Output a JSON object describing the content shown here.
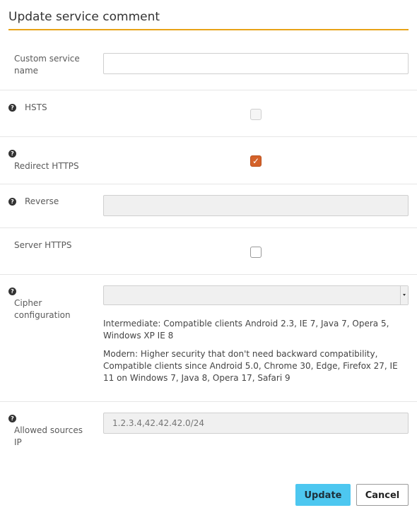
{
  "dialog": {
    "title": "Update service comment"
  },
  "fields": {
    "custom_service_name": {
      "label": "Custom service name",
      "value": ""
    },
    "hsts": {
      "label": "HSTS",
      "checked": false,
      "disabled": true
    },
    "redirect_https": {
      "label": "Redirect HTTPS",
      "checked": true
    },
    "reverse": {
      "label": "Reverse",
      "value": ""
    },
    "server_https": {
      "label": "Server HTTPS",
      "checked": false
    },
    "cipher_configuration": {
      "label_line1": "Cipher",
      "label_line2": "configuration",
      "selected": "",
      "help_intermediate": "Intermediate: Compatible clients Android 2.3, IE 7, Java 7, Opera 5, Windows XP IE 8",
      "help_modern": "Modern: Higher security that don't need backward compatibility, Compatible clients since Android 5.0, Chrome 30, Edge, Firefox 27, IE 11 on Windows 7, Java 8, Opera 17, Safari 9"
    },
    "allowed_sources_ip": {
      "label_line1": "Allowed sources",
      "label_line2": "IP",
      "placeholder": "1.2.3.4,42.42.42.0/24",
      "value": ""
    }
  },
  "actions": {
    "update_label": "Update",
    "cancel_label": "Cancel"
  },
  "icons": {
    "help": "question-circle-icon",
    "check": "check-icon",
    "dropdown": "caret-down-icon"
  },
  "colors": {
    "accent_rule": "#e8a317",
    "checkbox_checked": "#d4622a",
    "primary_button": "#4dc7f0"
  }
}
